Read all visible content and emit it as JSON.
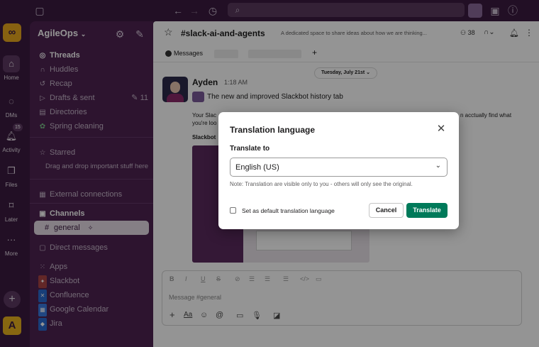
{
  "workspace": {
    "name": "AgileOps"
  },
  "rail": {
    "items": [
      {
        "label": "Home",
        "icon": "home-icon"
      },
      {
        "label": "DMs",
        "icon": "dms-icon"
      },
      {
        "label": "Activity",
        "icon": "bell-icon",
        "badge": "15"
      },
      {
        "label": "Files",
        "icon": "files-icon"
      },
      {
        "label": "Later",
        "icon": "bookmark-icon"
      },
      {
        "label": "More",
        "icon": "more-icon"
      }
    ],
    "user_initial": "A"
  },
  "sidebar": {
    "threads": "Threads",
    "huddles": "Huddles",
    "recap": "Recap",
    "drafts": "Drafts & sent",
    "drafts_count": "11",
    "directories": "Directories",
    "spring": "Spring cleaning",
    "starred": "Starred",
    "starred_hint": "Drag and drop important stuff here",
    "external": "External connections",
    "channels": "Channels",
    "channel_general": "general",
    "direct_messages": "Direct messages",
    "apps": "Apps",
    "app_list": [
      "Slackbot",
      "Confluence",
      "Google Calendar",
      "Jira"
    ]
  },
  "channel": {
    "name": "#slack-ai-and-agents",
    "topic": "A dedicated space to share ideas about how we are thinking...",
    "members": "38",
    "tab_messages": "Messages",
    "date": "Tuesday, July 21st"
  },
  "message": {
    "author": "Ayden",
    "time": "1:18 AM",
    "headline": "The new and improved Slackbot history tab",
    "body_start": "Your Slac",
    "body_end": "n acctually find what",
    "body_line2": "you're loo",
    "sub": "Slackbot"
  },
  "composer": {
    "placeholder": "Message #general"
  },
  "modal": {
    "title": "Translation language",
    "field_label": "Translate to",
    "selected": "English (US)",
    "note": "Note: Translation are visible only to you - others will only see the original.",
    "checkbox_label": "Set as default translation language",
    "cancel": "Cancel",
    "translate": "Translate"
  },
  "colors": {
    "accent": "#007a5a",
    "sidebar": "#4e2452",
    "rail": "#3b1b40",
    "brand": "#e8a81e"
  }
}
